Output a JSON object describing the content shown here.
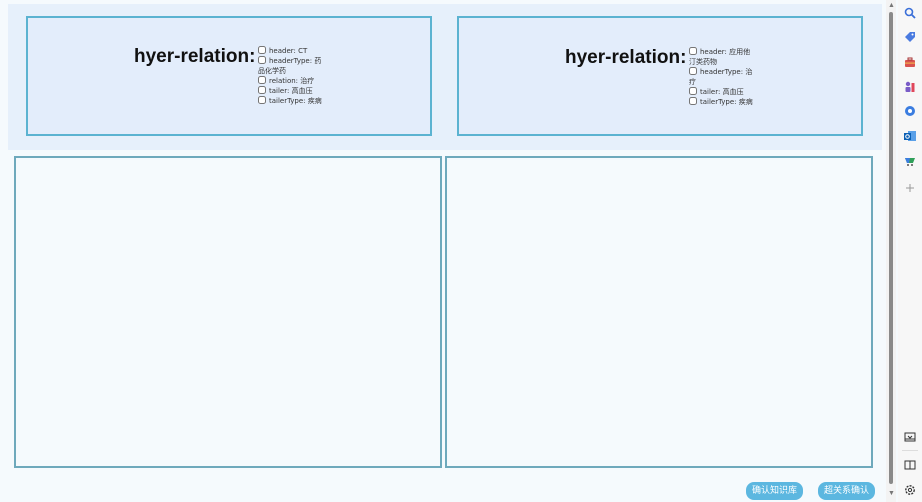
{
  "cards": [
    {
      "title": "hyer-relation:",
      "checks": [
        {
          "label": "header: CT"
        },
        {
          "label": "headerType: 药品化学药"
        },
        {
          "label": "relation: 治疗"
        },
        {
          "label": "tailer: 高血压"
        },
        {
          "label": "tailerType: 疾病"
        }
      ]
    },
    {
      "title": "hyer-relation:",
      "checks": [
        {
          "label": "header: 应用他汀类药物"
        },
        {
          "label": "headerType: 治疗"
        },
        {
          "label": "tailer: 高血压"
        },
        {
          "label": "tailerType: 疾病"
        }
      ]
    }
  ],
  "buttons": {
    "confirm_kb": "确认知识库",
    "confirm_hyper": "超关系确认"
  },
  "sidebar_icons": [
    "search-icon",
    "tag-icon",
    "toolbox-icon",
    "person-chess-icon",
    "extension-icon",
    "outlook-icon",
    "shopping-icon",
    "add-icon",
    "panel-icon",
    "reader-icon",
    "settings-icon"
  ],
  "colors": {
    "card_bg": "#e3edfb",
    "card_border": "#5bb3d1",
    "panel_border": "#6ea9bc",
    "button_bg": "#5cb7e0"
  }
}
